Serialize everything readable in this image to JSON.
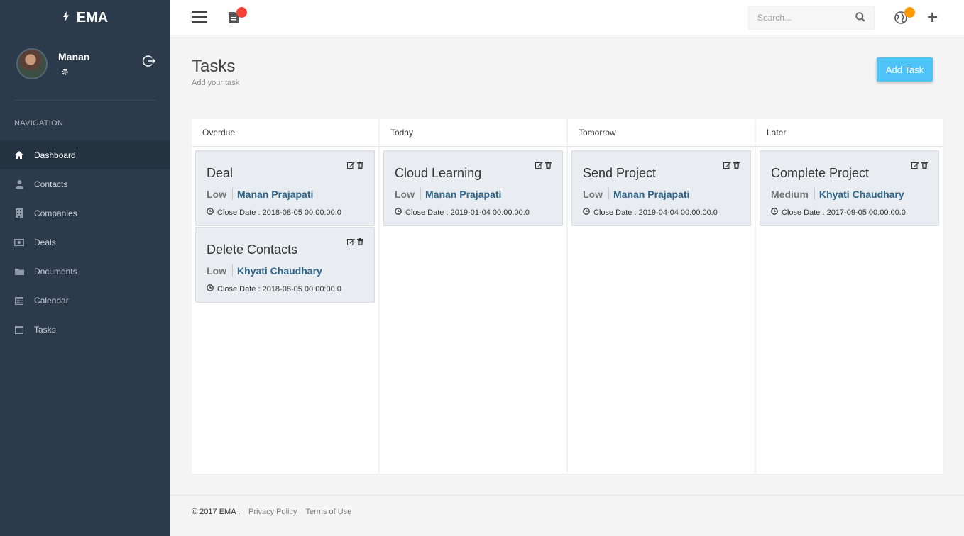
{
  "app": {
    "name": "EMA"
  },
  "user": {
    "name": "Manan"
  },
  "navigation": {
    "title": "NAVIGATION",
    "items": [
      {
        "label": "Dashboard",
        "icon": "home-icon",
        "active": true
      },
      {
        "label": "Contacts",
        "icon": "user-icon"
      },
      {
        "label": "Companies",
        "icon": "building-icon"
      },
      {
        "label": "Deals",
        "icon": "money-icon"
      },
      {
        "label": "Documents",
        "icon": "folder-icon"
      },
      {
        "label": "Calendar",
        "icon": "calendar-icon"
      },
      {
        "label": "Tasks",
        "icon": "calendar-blank-icon"
      }
    ]
  },
  "topbar": {
    "search_placeholder": "Search..."
  },
  "page": {
    "title": "Tasks",
    "subtitle": "Add your task",
    "add_button": "Add Task"
  },
  "columns": [
    {
      "title": "Overdue",
      "cards": [
        {
          "title": "Deal",
          "priority": "Low",
          "owner": "Manan Prajapati",
          "close_date": "Close Date : 2018-08-05 00:00:00.0"
        },
        {
          "title": "Delete Contacts",
          "priority": "Low",
          "owner": "Khyati Chaudhary",
          "close_date": "Close Date : 2018-08-05 00:00:00.0"
        }
      ]
    },
    {
      "title": "Today",
      "cards": [
        {
          "title": "Cloud Learning",
          "priority": "Low",
          "owner": "Manan Prajapati",
          "close_date": "Close Date : 2019-01-04 00:00:00.0"
        }
      ]
    },
    {
      "title": "Tomorrow",
      "cards": [
        {
          "title": "Send Project",
          "priority": "Low",
          "owner": "Manan Prajapati",
          "close_date": "Close Date : 2019-04-04 00:00:00.0"
        }
      ]
    },
    {
      "title": "Later",
      "cards": [
        {
          "title": "Complete Project",
          "priority": "Medium",
          "owner": "Khyati Chaudhary",
          "close_date": "Close Date : 2017-09-05 00:00:00.0"
        }
      ]
    }
  ],
  "footer": {
    "copyright": "© 2017 EMA .",
    "links": [
      "Privacy Policy",
      "Terms of Use"
    ]
  },
  "colors": {
    "sidebar": "#2b3b4b",
    "accent": "#4fc3f7",
    "owner_link": "#2e6489",
    "badge_red": "#f44336",
    "badge_orange": "#ff9800"
  }
}
